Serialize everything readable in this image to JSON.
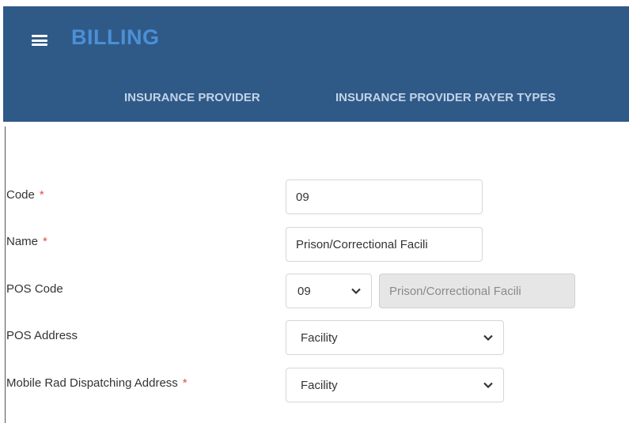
{
  "header": {
    "app_title": "BILLING",
    "tabs": [
      {
        "label": "INSURANCE PROVIDER"
      },
      {
        "label": "INSURANCE PROVIDER PAYER TYPES"
      }
    ]
  },
  "form": {
    "code": {
      "label": "Code",
      "required_mark": "*",
      "value": "09"
    },
    "name": {
      "label": "Name",
      "required_mark": "*",
      "value": "Prison/Correctional Facili"
    },
    "pos_code": {
      "label": "POS Code",
      "selected": "09",
      "description": "Prison/Correctional Facili"
    },
    "pos_address": {
      "label": "POS Address",
      "selected": "Facility"
    },
    "mobile_rad_dispatching_address": {
      "label": "Mobile Rad Dispatching Address",
      "required_mark": "*",
      "selected": "Facility"
    }
  },
  "colors": {
    "header_bg": "#2f5a88",
    "title": "#4c8fd6",
    "tab_text": "#c2d3e6",
    "required": "#d9534f"
  }
}
